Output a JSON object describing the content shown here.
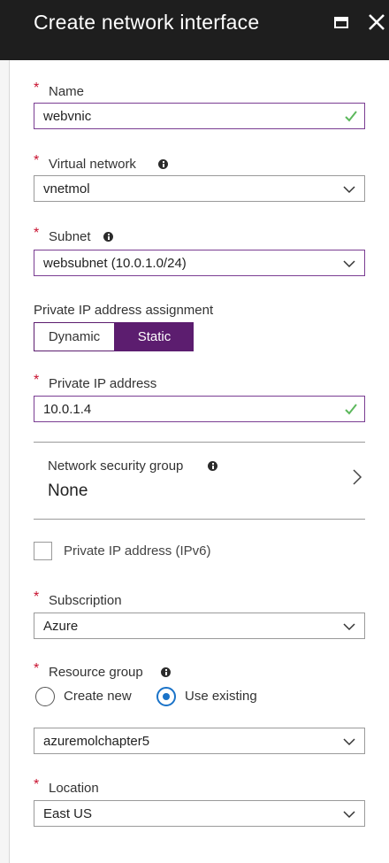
{
  "header": {
    "title": "Create network interface"
  },
  "form": {
    "name": {
      "label": "Name",
      "value": "webvnic"
    },
    "virtual_network": {
      "label": "Virtual network",
      "value": "vnetmol"
    },
    "subnet": {
      "label": "Subnet",
      "value": "websubnet (10.0.1.0/24)"
    },
    "ip_assignment": {
      "label": "Private IP address assignment",
      "options": [
        "Dynamic",
        "Static"
      ],
      "selected": "Static"
    },
    "private_ip": {
      "label": "Private IP address",
      "value": "10.0.1.4"
    },
    "nsg": {
      "label": "Network security group",
      "value": "None"
    },
    "ipv6": {
      "label": "Private IP address (IPv6)",
      "checked": false
    },
    "subscription": {
      "label": "Subscription",
      "value": "Azure"
    },
    "resource_group": {
      "label": "Resource group",
      "create_new_label": "Create new",
      "use_existing_label": "Use existing",
      "selected": "Use existing",
      "value": "azuremolchapter5"
    },
    "location": {
      "label": "Location",
      "value": "East US"
    }
  },
  "colors": {
    "header_bg": "#1e1e1e",
    "accent_purple": "#5c1d6f",
    "valid_check": "#5cb85c",
    "required_star": "#c8102e",
    "radio_blue": "#1a73c8"
  },
  "icons": [
    "maximize-icon",
    "close-icon",
    "info-icon",
    "check-icon",
    "chevron-down-icon",
    "chevron-right-icon"
  ]
}
